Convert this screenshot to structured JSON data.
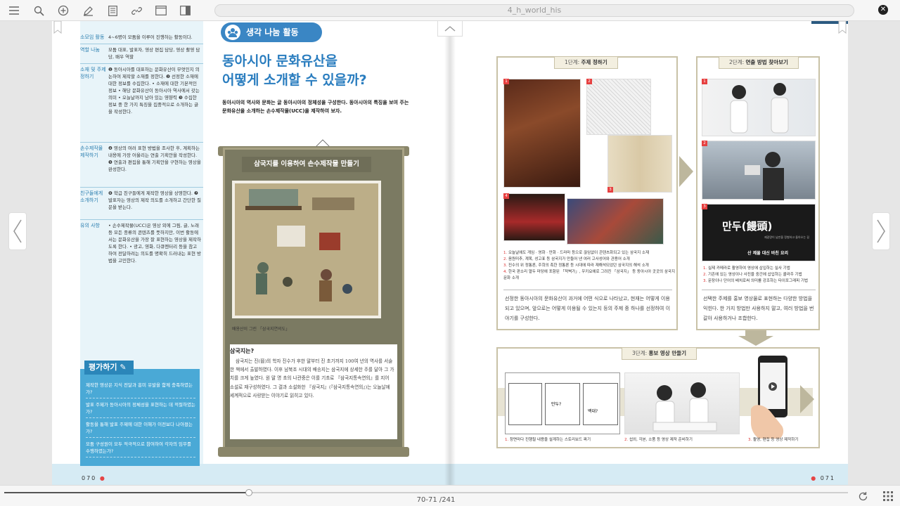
{
  "toolbar": {
    "document_title": "4_h_world_his"
  },
  "left_page": {
    "page_number": "070",
    "activity_badge": "생각 나눔 활동",
    "main_title_line1": "동아시아 문화유산을",
    "main_title_line2": "어떻게 소개할 수 있을까?",
    "main_desc": "동아시아의 역사와 문화는 글 동아시아의 정체성을 구성한다. 동아시아의 특징을 보여 주는 문화유산을 소개하는 손수제작물(UCC)을 제작하여 보자.",
    "sidebar": [
      {
        "key": "소모임 활동",
        "value": "4~6명이 모둠을 이루어 진행하는 활동이다."
      },
      {
        "key": "역할 나눔",
        "value": "모둠 대표, 발표자, 영상 편집 담당, 영상 촬영 담당, 배우 역할"
      },
      {
        "key": "소재 및 주제 정하기",
        "value": "❶ 동아시아를 대표하는 문화유산이 무엇인지 의논하여 제작할 소재를 정한다. ❷ 선정한 소재에 대한 정보를 수집한다. • 소재에 대한 기본적인 정보 • 해당 문화유산이 동아시아 역사에서 갖는 의미 • 오늘날까지 남아 있는 영향력 ❸ 수집한 정보 중 한 가지 특징을 집중적으로 소개하는 글을 작성한다."
      },
      {
        "key": "손수제작물 제작하기",
        "value": "❹ 영상의 여러 표현 방법을 조사한 후, 계획하는 내용에 가장 어울리는 연출 기획안을 작성한다. ❺ 연출과 편집을 통해 기획안을 구현하는 영상을 완성한다."
      },
      {
        "key": "친구들에게 소개하기",
        "value": "❻ 학급 친구들에게 제작한 영상을 상영한다. ❼ 발표자는 영상의 제작 의도를 소개하고 간단한 질문을 받는다."
      },
      {
        "key": "유의 사항",
        "value": "• 손수제작물(UCC)은 영상 외에 그림, 글, 노래 등 모든 종류의 콘텐츠를 뜻하지만, 이번 활동에서는 문화유산을 가장 잘 표현하는 영상을 제작하도록 한다. • 광고, 영화, 다큐멘터리 등을 참고하여 전달하려는 의도를 명확히 드러내는 표현 방법을 고민한다."
      }
    ],
    "evaluation": {
      "title": "평가하기",
      "items": [
        "제작한 영상은 지식 전달과 흥미 유발을 함께 충족하였는가?",
        "발표 주제가 동아시아의 정체성을 표현하는 데 적절하였는가?",
        "활동을 통해 발표 주제에 대한 이해가 이전보다 나아졌는가?",
        "모둠 구성원이 모두 적극적으로 참여하여 각자의 임무를 수행하였는가?"
      ]
    },
    "scroll": {
      "banner": "삼국지를 이용하여 손수제작물 만들기",
      "painting_caption": "배용산이 그린 「삼국지연의도」",
      "subhead": "삼국지는?",
      "body": "삼국지는 진(晉)의 학자 진수가 후한 말부터 진 초기까지 100여 년의 역사를 서술한 책에서 출발하였다. 이후 남북조 시대의 배송지는 삼국지에 상세한 주를 달아 그 가치를 크게 높였다. 원 말 명 초의 나관중은 이를 기초로 『삼국지통속연의』를 지어 소설로 재구성하였다. 그 결과 소설화한 『삼국지』(『삼국지통속연의』)는 오늘날에 세계적으로 사랑받는 이야기로 읽히고 있다."
    }
  },
  "right_page": {
    "page_number": "071",
    "stage1": {
      "tag_prefix": "1단계:",
      "tag_label": "주제 정하기",
      "captions": [
        "오늘날에도 게임 · 영화 · 만화 · 드라마 등으로 끊임없이 콘텐츠화되고 있는 삼국지 소재",
        "음원미추, 계목, 성고표 등 삼국지가 만들어 낸 여러 고사성어와 관용어 소개",
        "진수의 위 정통론, 주희의 촉한 정통론 등 시대에 따라 재해석되었던 삼국지의 해석 소개",
        "한국 판소리 열두 마당에 포함된 「적벽가」, 우키요에로 그려진 「삼국지」 등 동아시아 곳곳의 삼국지 문화 소개"
      ],
      "paragraph": "선정한 동아시아의 문화유산이 과거에 어떤 식으로 나타났고, 현재는 어떻게 이용되고 있으며, 앞으로는 어떻게 이용될 수 있는지 등의 주제 중 하나를 선정하여 이야기를 구성한다."
    },
    "stage2": {
      "tag_prefix": "2단계:",
      "tag_label": "연출 방법 찾아보기",
      "title_card": "만두(饅頭)",
      "title_card_small": "제갈량이 남만을 정벌하고 돌아오는 길",
      "title_card_sub": "산 제물 대신 바친 요리",
      "captions": [
        "실제 카메라로 촬영하여 영상에 삽입하는 실사 기법",
        "기존에 있는 영상이나 사진을 중간에 삽입하는 콜라주 기법",
        "문장이나 단어의 배치로써 의미를 강조하는 타이포그래피 기법"
      ],
      "paragraph": "선택한 주제를 홍보 영상물로 표현하는 다양한 방법을 익힌다. 한 가지 방법만 사용하지 말고, 여러 방법을 번갈아 사용하거나 조합한다."
    },
    "stage3": {
      "tag_prefix": "3단계:",
      "tag_label": "홍보 영상 만들기",
      "storyboard_text_1": "만두?",
      "storyboard_text_2": "백대?",
      "captions": [
        "창면마다 진행될 내용을 설계하는 스토리보드 짜기",
        "섭외, 각본, 소품 등 영상 제작 준비하기",
        "촬영, 편집 등 영상 제작하기"
      ]
    }
  },
  "footer": {
    "page_indicator": "70-71 /241",
    "progress_fraction": 0.29
  },
  "colors": {
    "accent_blue": "#2a7dbf",
    "sidebar_bg": "#e8f4f9",
    "eval_bg": "#4aa9d6",
    "scroll_bg": "#7b7a62",
    "highlight_red": "#e64040"
  }
}
